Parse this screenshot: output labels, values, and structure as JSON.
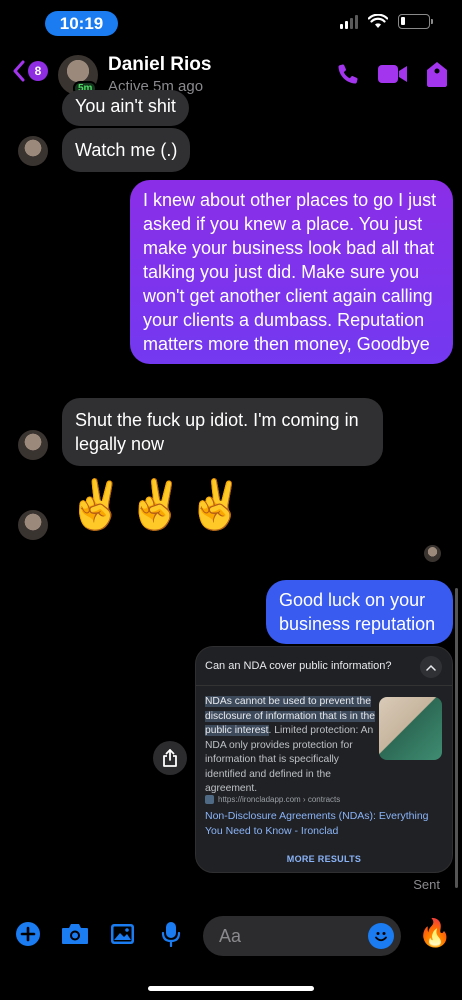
{
  "status_bar": {
    "time": "10:19"
  },
  "header": {
    "unread_count": "8",
    "contact_name": "Daniel Rios",
    "active_badge": "5m",
    "contact_status": "Active 5m ago",
    "accent_color": "#a335ee"
  },
  "messages": [
    {
      "id": "m1",
      "direction": "incoming",
      "text": "You ain't shit"
    },
    {
      "id": "m2",
      "direction": "incoming",
      "text": "Watch me (.)"
    },
    {
      "id": "m3",
      "direction": "outgoing",
      "text": "I knew about other places to go I just asked if you knew a place. You just make your business look bad all that talking you just did. Make sure you won't get another client again calling your clients a dumbass. Reputation matters more then money, Goodbye"
    },
    {
      "id": "m4",
      "direction": "incoming",
      "text": "Shut the fuck up idiot. I'm coming in legally now"
    },
    {
      "id": "m5",
      "direction": "incoming",
      "text": "✌️✌️✌️"
    },
    {
      "id": "m6",
      "direction": "outgoing",
      "text": "Good luck on your business reputation"
    }
  ],
  "search_card": {
    "question": "Can an NDA cover public information?",
    "snippet_highlight": "NDAs cannot be used to prevent the disclosure of information that is in the public interest",
    "snippet_rest": ". Limited protection: An NDA only provides protection for information that is specifically identified and defined in the agreement.",
    "source": "https://ironcladapp.com › contracts",
    "link_title": "Non-Disclosure Agreements (NDAs): Everything You Need to Know - Ironclad",
    "more_results": "MORE RESULTS"
  },
  "delivery_status": "Sent",
  "composer": {
    "placeholder": "Aa"
  }
}
